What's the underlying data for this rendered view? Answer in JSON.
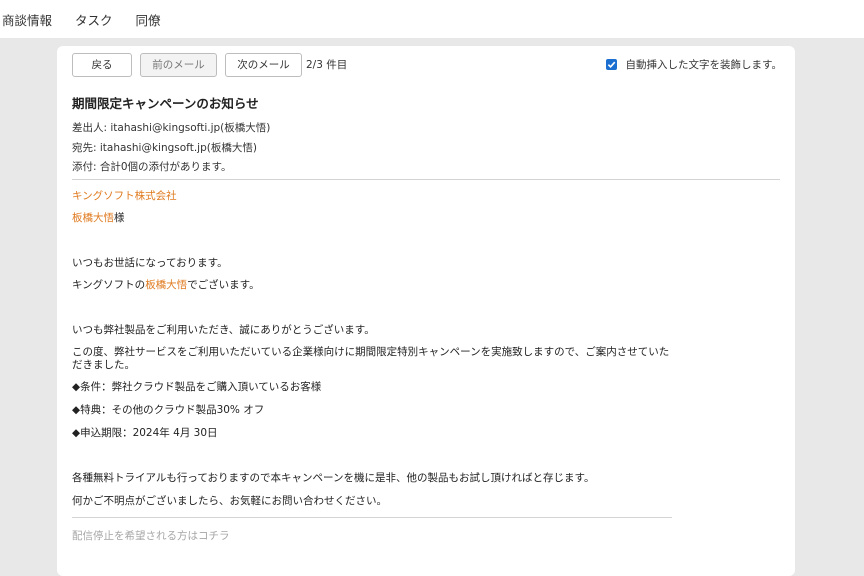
{
  "topnav": {
    "tabs": [
      {
        "label": "商談情報"
      },
      {
        "label": "タスク"
      },
      {
        "label": "同僚"
      }
    ]
  },
  "toolbar": {
    "back_label": "戻る",
    "prev_label": "前のメール",
    "next_label": "次のメール",
    "counter": "2/3 件目",
    "auto_decorate_label": "自動挿入した文字を装飾します。",
    "auto_decorate_checked": true
  },
  "email": {
    "subject": "期間限定キャンペーンのお知らせ",
    "from": "差出人: itahashi@kingsofti.jp(板橋大悟)",
    "to": "宛先: itahashi@kingsoft.jp(板橋大悟)",
    "attachment": "添付: 合計0個の添付があります。",
    "body": {
      "company": "キングソフト株式会社",
      "recipient_name": "板橋大悟",
      "recipient_suffix": "様",
      "greeting": "いつもお世話になっております。",
      "intro_prefix": "キングソフトの",
      "intro_name": "板橋大悟",
      "intro_suffix": "でございます。",
      "thanks": "いつも弊社製品をご利用いただき、誠にありがとうございます。",
      "announce": "この度、弊社サービスをご利用いただいている企業様向けに期間限定特別キャンペーンを実施致しますので、ご案内させていただきました。",
      "condition": "◆条件：弊社クラウド製品をご購入頂いているお客様",
      "benefit": "◆特典：その他のクラウド製品30% オフ",
      "deadline": "◆申込期限：2024年 4月 30日",
      "trial": "各種無料トライアルも行っておりますので本キャンペーンを機に是非、他の製品もお試し頂ければと存じます。",
      "contact": "何かご不明点がございましたら、お気軽にお問い合わせください。",
      "unsubscribe": "配信停止を希望される方はコチラ"
    }
  }
}
